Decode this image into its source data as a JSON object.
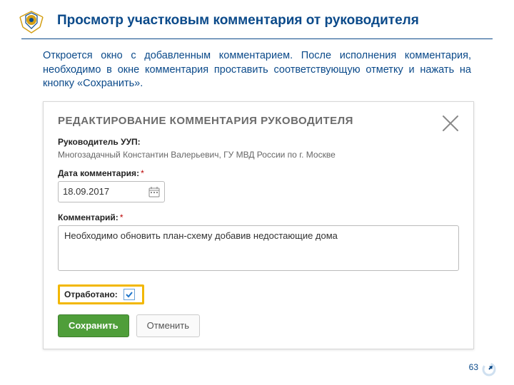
{
  "page": {
    "title": "Просмотр участковым комментария от руководителя",
    "intro": "Откроется окно с добавленным комментарием. После исполнения комментария, необходимо в окне комментария проставить соответствующую отметку и нажать на кнопку «Сохранить».",
    "page_number": "63"
  },
  "dialog": {
    "title": "РЕДАКТИРОВАНИЕ КОММЕНТАРИЯ РУКОВОДИТЕЛЯ",
    "fields": {
      "supervisor_label": "Руководитель УУП:",
      "supervisor_value": "Многозадачный Константин Валерьевич, ГУ МВД России по г. Москве",
      "date_label": "Дата комментария:",
      "date_value": "18.09.2017",
      "comment_label": "Комментарий:",
      "comment_value": "Необходимо обновить план-схему добавив недостающие дома",
      "done_label": "Отработано:",
      "required_mark": "*"
    },
    "buttons": {
      "save": "Сохранить",
      "cancel": "Отменить"
    }
  }
}
